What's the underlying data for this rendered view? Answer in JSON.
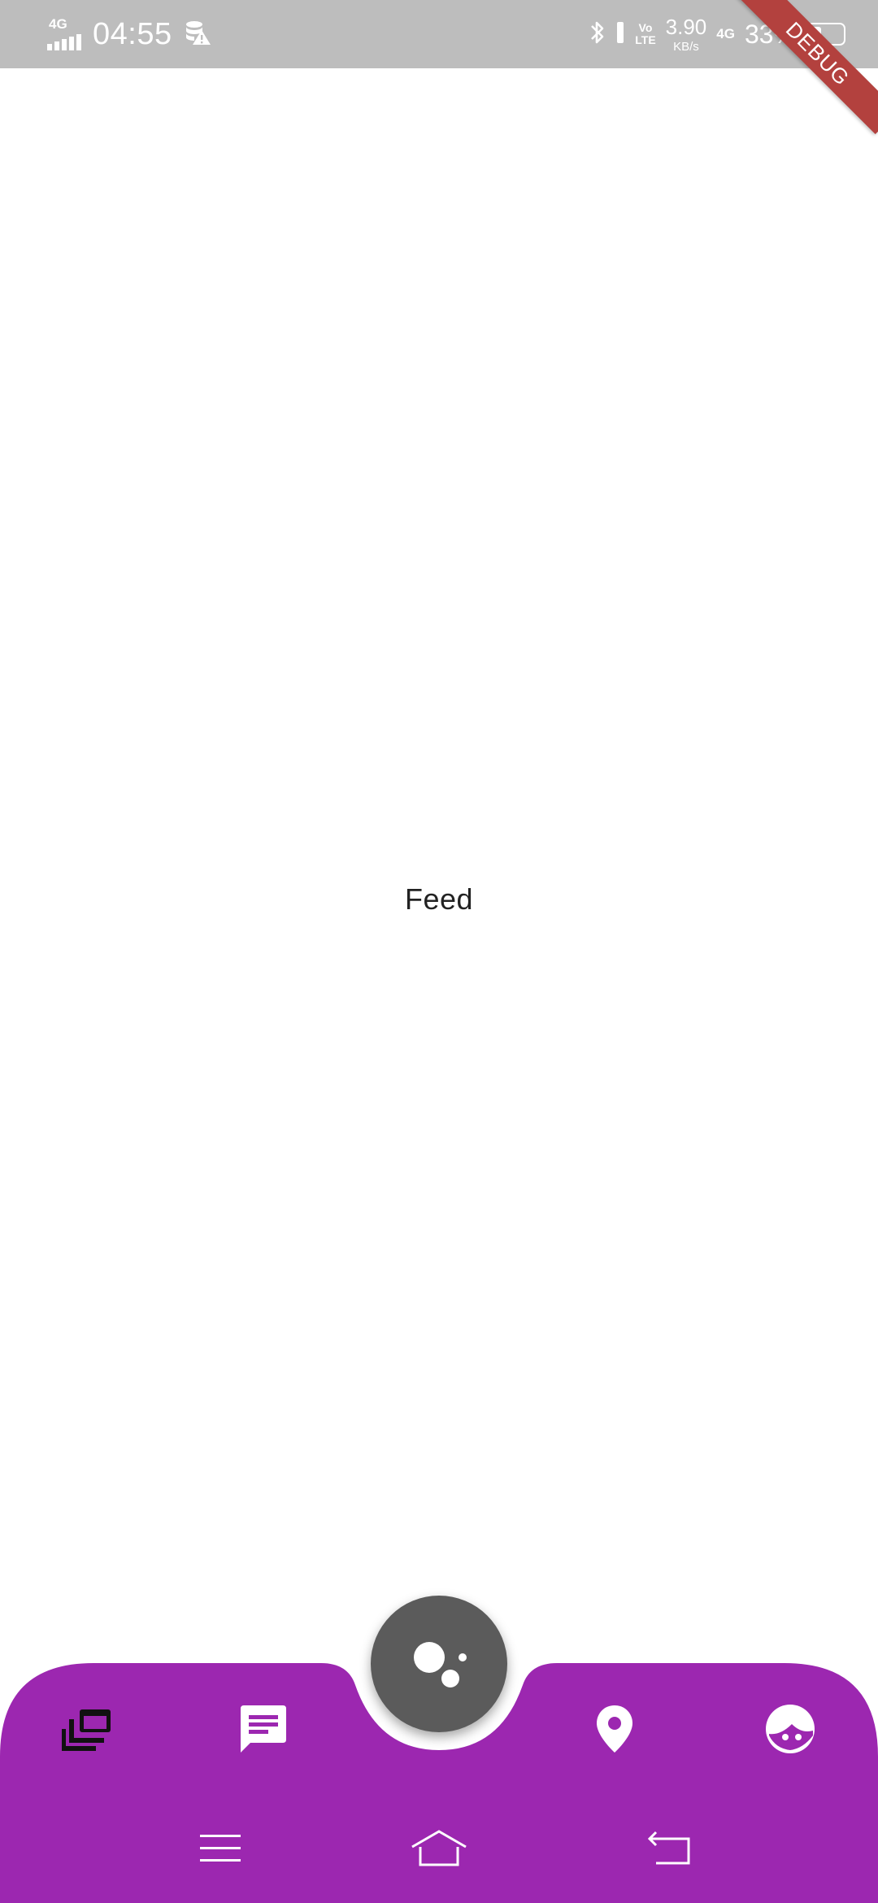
{
  "status_bar": {
    "network_left": "4G",
    "time": "04:55",
    "volte_line1": "Vo",
    "volte_line2": "LTE",
    "speed_value": "3.90",
    "speed_unit": "KB/s",
    "network_right": "4G",
    "battery_percent": "33%",
    "battery_level": 0.33,
    "icons": [
      "signal-icon",
      "data-saver-icon",
      "bluetooth-icon",
      "vibrate-icon",
      "battery-icon"
    ]
  },
  "debug_banner": {
    "label": "DEBUG",
    "color": "#b3413e"
  },
  "main": {
    "title": "Feed"
  },
  "bottom_nav": {
    "background": "#9c27b0",
    "items": [
      {
        "name": "feed",
        "icon": "dynamic-feed-icon",
        "active": true
      },
      {
        "name": "messages",
        "icon": "message-icon",
        "active": false
      },
      {
        "name": "location",
        "icon": "location-pin-icon",
        "active": false
      },
      {
        "name": "profile",
        "icon": "face-icon",
        "active": false
      }
    ],
    "fab": {
      "icon": "bubbles-icon",
      "color": "#5b5b5b"
    }
  },
  "system_nav": {
    "buttons": [
      "menu-icon",
      "home-icon",
      "back-icon"
    ]
  }
}
